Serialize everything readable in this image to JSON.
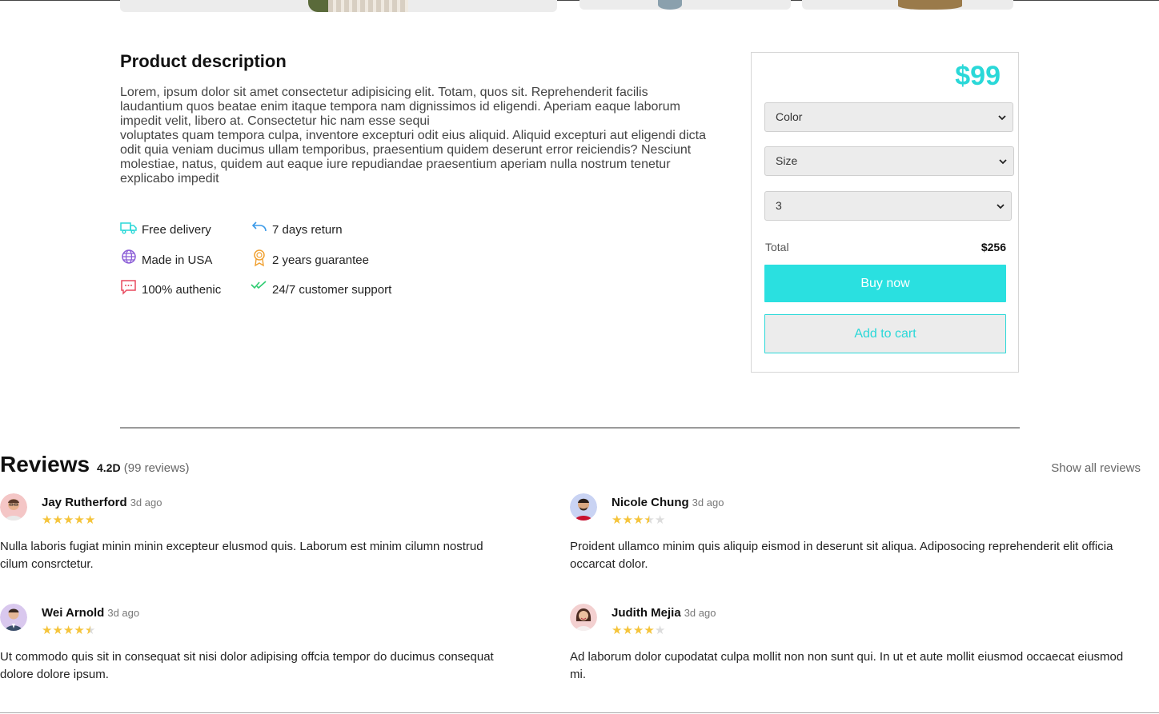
{
  "description": {
    "title": "Product description",
    "text": "Lorem, ipsum dolor sit amet consectetur adipisicing elit. Totam, quos sit. Reprehenderit facilis laudantium quos beatae enim itaque tempora nam dignissimos id eligendi. Aperiam eaque laborum impedit velit, libero at. Consectetur hic nam esse sequi\nvoluptates quam tempora culpa, inventore excepturi odit eius aliquid. Aliquid excepturi aut eligendi dicta odit quia veniam ducimus ullam temporibus, praesentium quidem deserunt error reiciendis? Nesciunt molestiae, natus, quidem aut eaque iure repudiandae praesentium aperiam nulla nostrum tenetur explicabo impedit"
  },
  "features": [
    {
      "label": "Free delivery",
      "icon": "truck-icon",
      "color": "#2ad8d8"
    },
    {
      "label": "7 days return",
      "icon": "return-arrow-icon",
      "color": "#3b9ae8"
    },
    {
      "label": "Made in USA",
      "icon": "globe-icon",
      "color": "#8a5cd6"
    },
    {
      "label": "2 years guarantee",
      "icon": "award-icon",
      "color": "#f0a030"
    },
    {
      "label": "100% authenic",
      "icon": "chat-icon",
      "color": "#e84a5f"
    },
    {
      "label": "24/7 customer support",
      "icon": "double-check-icon",
      "color": "#2ecc71"
    }
  ],
  "purchase": {
    "price": "$99",
    "color_select": "Color",
    "size_select": "Size",
    "quantity_select": "3",
    "total_label": "Total",
    "total_value": "$256",
    "buy_label": "Buy now",
    "cart_label": "Add to cart",
    "accent": "#2ae0e0"
  },
  "reviews": {
    "title": "Reviews",
    "rating": "4.2D",
    "count": "(99 reviews)",
    "show_all": "Show all reviews",
    "items": [
      {
        "name": "Jay Rutherford",
        "ago": "3d ago",
        "stars": 5,
        "text": "Nulla laboris fugiat minin minin excepteur elusmod quis. Laborum est minim cilumn nostrud cilum consrctetur."
      },
      {
        "name": "Nicole Chung",
        "ago": "3d ago",
        "stars": 3.5,
        "text": "Proident ullamco minim quis aliquip eismod in deserunt sit aliqua. Adiposocing reprehenderit elit officia occarcat dolor."
      },
      {
        "name": "Wei Arnold",
        "ago": "3d ago",
        "stars": 4.5,
        "text": "Ut commodo quis sit in consequat sit nisi dolor adipising offcia tempor do ducimus consequat dolore dolore ipsum."
      },
      {
        "name": "Judith Mejia",
        "ago": "3d ago",
        "stars": 4,
        "text": "Ad laborum dolor cupodatat culpa mollit non non sunt qui. In ut et aute mollit eiusmod occaecat eiusmod mi."
      }
    ]
  }
}
